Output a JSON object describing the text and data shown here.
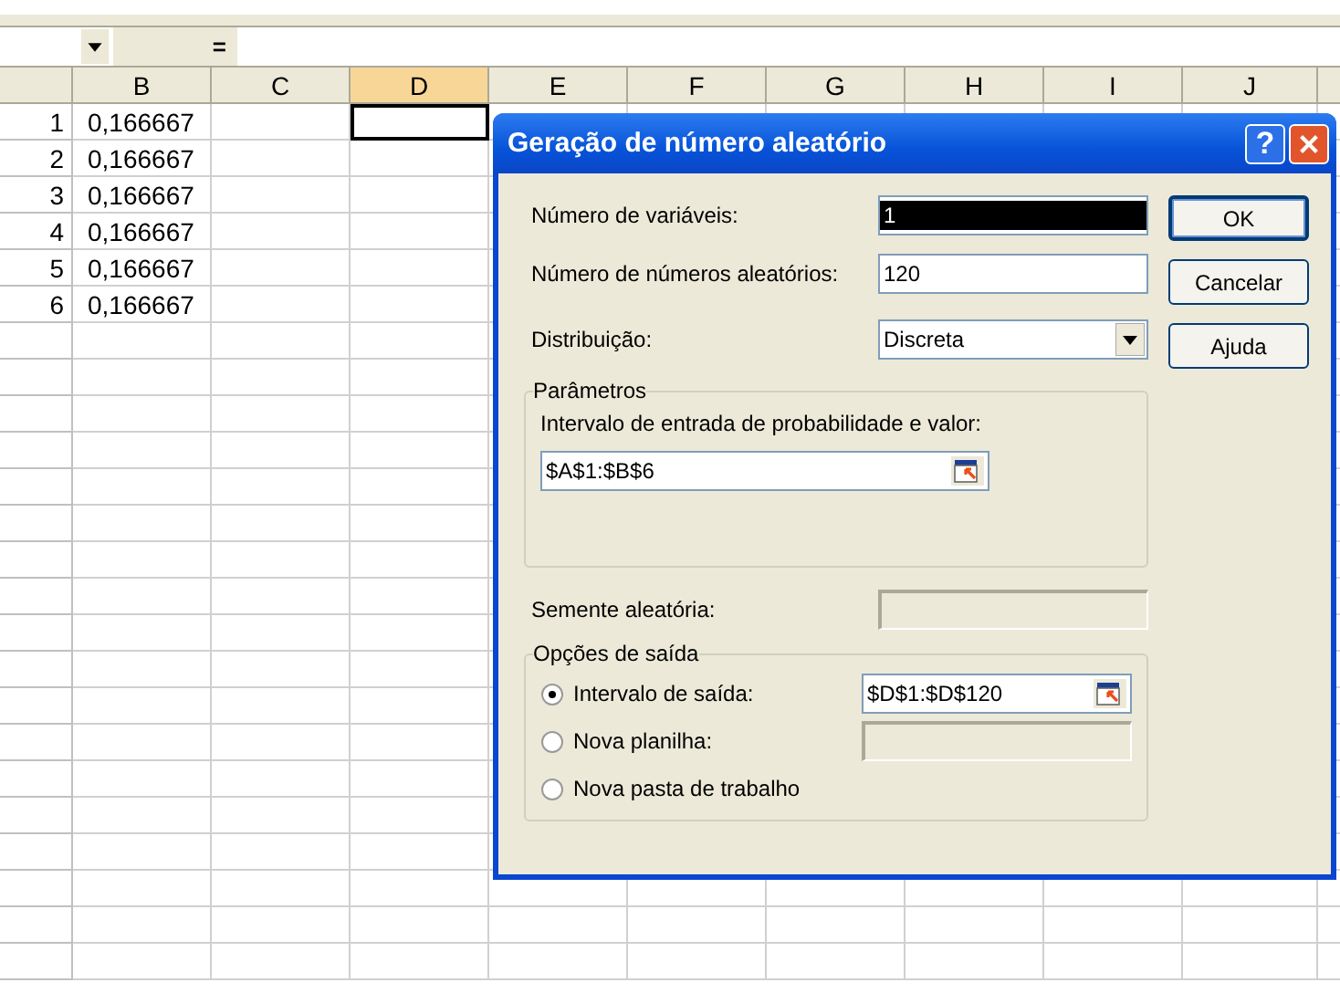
{
  "formula_bar": {
    "equals": "="
  },
  "columns": [
    {
      "label": "B",
      "selected": false
    },
    {
      "label": "C",
      "selected": false
    },
    {
      "label": "D",
      "selected": true
    },
    {
      "label": "E",
      "selected": false
    },
    {
      "label": "F",
      "selected": false
    },
    {
      "label": "G",
      "selected": false
    },
    {
      "label": "H",
      "selected": false
    },
    {
      "label": "I",
      "selected": false
    },
    {
      "label": "J",
      "selected": false
    }
  ],
  "rows": [
    {
      "number": "1",
      "value": "0,166667"
    },
    {
      "number": "2",
      "value": "0,166667"
    },
    {
      "number": "3",
      "value": "0,166667"
    },
    {
      "number": "4",
      "value": "0,166667"
    },
    {
      "number": "5",
      "value": "0,166667"
    },
    {
      "number": "6",
      "value": "0,166667"
    }
  ],
  "dialog": {
    "title": "Geração de número aleatório",
    "help": "?",
    "fields": [
      {
        "label": "Número de variáveis:",
        "value": "1",
        "highlighted": true
      },
      {
        "label": "Número de números aleatórios:",
        "value": "120",
        "highlighted": false
      }
    ],
    "distribution": {
      "label": "Distribuição:",
      "value": "Discreta"
    },
    "buttons": [
      {
        "label": "OK",
        "default": true
      },
      {
        "label": "Cancelar",
        "default": false
      },
      {
        "label": "Ajuda",
        "default": false
      }
    ],
    "parameters": {
      "title": "Parâmetros",
      "label": "Intervalo de entrada de probabilidade e valor:",
      "value": "$A$1:$B$6"
    },
    "seed": {
      "label": "Semente aleatória:"
    },
    "output": {
      "title": "Opções de saída",
      "options": [
        {
          "label": "Intervalo de saída:",
          "selected": true,
          "kind": "range",
          "value": "$D$1:$D$120"
        },
        {
          "label": "Nova planilha:",
          "selected": false,
          "kind": "field"
        },
        {
          "label": "Nova pasta de trabalho",
          "selected": false,
          "kind": "plain"
        }
      ]
    }
  }
}
